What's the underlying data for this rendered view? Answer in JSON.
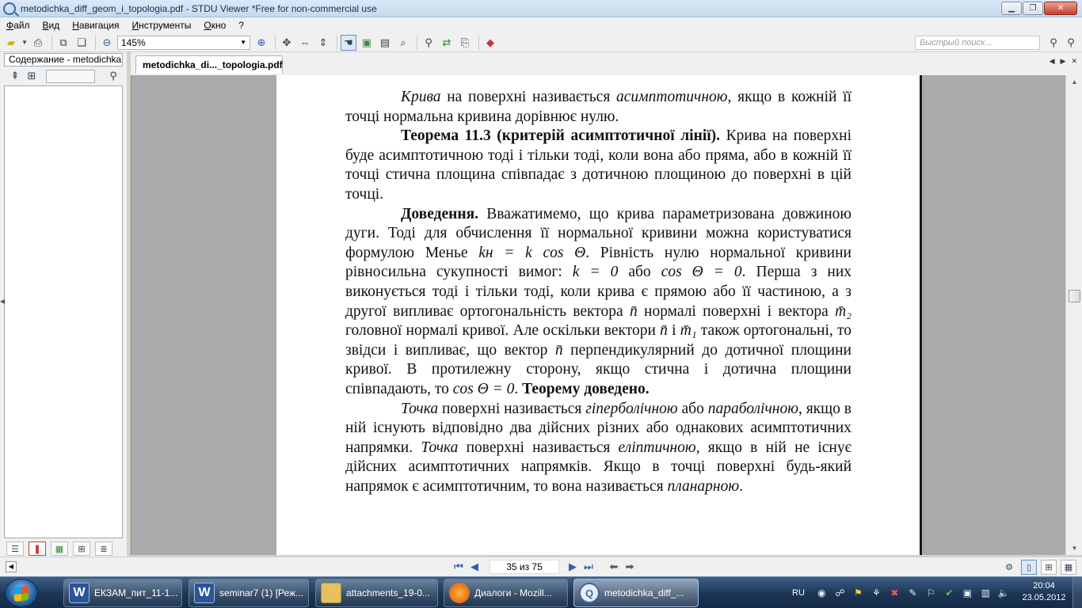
{
  "window": {
    "title": "metodichka_diff_geom_i_topologia.pdf - STDU Viewer *Free for non-commercial use",
    "controls": [
      "minimize",
      "maximize",
      "close"
    ]
  },
  "menu": [
    "Файл",
    "Вид",
    "Навигация",
    "Инструменты",
    "Окно",
    "?"
  ],
  "toolbar": {
    "zoom": "145%",
    "search_placeholder": "Быстрый поиск..."
  },
  "left_panel": {
    "tab_label": "Содержание - metodichka"
  },
  "doc_tab": {
    "label": "metodichka_di..._topologia.pdf"
  },
  "document": {
    "paragraphs": [
      [
        {
          "t": "Крива",
          "s": "i"
        },
        {
          "t": " на поверхні називається "
        },
        {
          "t": "асимптотичною",
          "s": "i"
        },
        {
          "t": ", якщо в кожній її точці нормальна кривина дорівнює нулю."
        }
      ],
      [
        {
          "t": "Теорема 11.3 (критерій асимптотичної лінії).",
          "s": "b"
        },
        {
          "t": " Крива на поверхні буде асимптотичною тоді і тільки тоді, коли вона або пряма, або в кожній її точці стична площина співпадає з дотичною площиною до поверхні в цій точці."
        }
      ],
      [
        {
          "t": "Доведення.",
          "s": "b"
        },
        {
          "t": " Вважатимемо, що крива параметризована довжиною дуги. Тоді для обчислення її нормальної кривини можна користуватися формулою Менье "
        },
        {
          "t": "kн = k cos Θ",
          "s": "m"
        },
        {
          "t": ". Рівність нулю нормальної кривини рівносильна сукупності вимог: "
        },
        {
          "t": "k = 0",
          "s": "m"
        },
        {
          "t": " або "
        },
        {
          "t": "cos Θ = 0",
          "s": "m"
        },
        {
          "t": ". Перша з них виконується тоді і тільки тоді, коли крива є прямою або її частиною, а з другої випливає ортогональність вектора "
        },
        {
          "t": "n̄",
          "s": "m"
        },
        {
          "t": " нормалі поверхні і вектора "
        },
        {
          "t": "m̄₂",
          "s": "m"
        },
        {
          "t": " головної нормалі кривої. Але оскільки вектори "
        },
        {
          "t": "n̄",
          "s": "m"
        },
        {
          "t": " і "
        },
        {
          "t": "m̄₁",
          "s": "m"
        },
        {
          "t": " також ортогональні, то звідси і випливає, що вектор "
        },
        {
          "t": "n̄",
          "s": "m"
        },
        {
          "t": " перпендикулярний до дотичної площини кривої. В протилежну сторону, якщо стична і дотична площини співпадають, то "
        },
        {
          "t": "cos Θ = 0",
          "s": "m"
        },
        {
          "t": ". "
        },
        {
          "t": "Теорему доведено.",
          "s": "b"
        }
      ],
      [
        {
          "t": "Точка",
          "s": "i"
        },
        {
          "t": " поверхні називається "
        },
        {
          "t": "гіперболічною",
          "s": "i"
        },
        {
          "t": " або "
        },
        {
          "t": "параболічною",
          "s": "i"
        },
        {
          "t": ", якщо в ній існують відповідно два дійсних різних або однакових асимптотичних напрямки. "
        },
        {
          "t": "Точка",
          "s": "i"
        },
        {
          "t": " поверхні називається "
        },
        {
          "t": "еліптичною",
          "s": "i"
        },
        {
          "t": ", якщо в ній не існує дійсних асимптотичних напрямків. Якщо в точці поверхні будь-який напрямок є асимптотичним, то вона називається "
        },
        {
          "t": "планарною",
          "s": "i"
        },
        {
          "t": "."
        }
      ]
    ]
  },
  "navigation": {
    "page_indicator": "35 из 75"
  },
  "taskbar": {
    "tasks": [
      {
        "label": "ЕКЗАМ_пит_11-1...",
        "icon": "word-icon",
        "glyph": "W"
      },
      {
        "label": "seminar7 (1) [Реж...",
        "icon": "word-icon",
        "glyph": "W"
      },
      {
        "label": "attachments_19-0...",
        "icon": "folder-icon",
        "glyph": ""
      },
      {
        "label": "Диалоги - Mozill...",
        "icon": "firefox-icon",
        "glyph": ""
      },
      {
        "label": "metodichka_diff_...",
        "icon": "stdu-viewer-icon",
        "glyph": "Q"
      }
    ],
    "language": "RU",
    "time": "20:04",
    "date": "23.05.2012"
  }
}
